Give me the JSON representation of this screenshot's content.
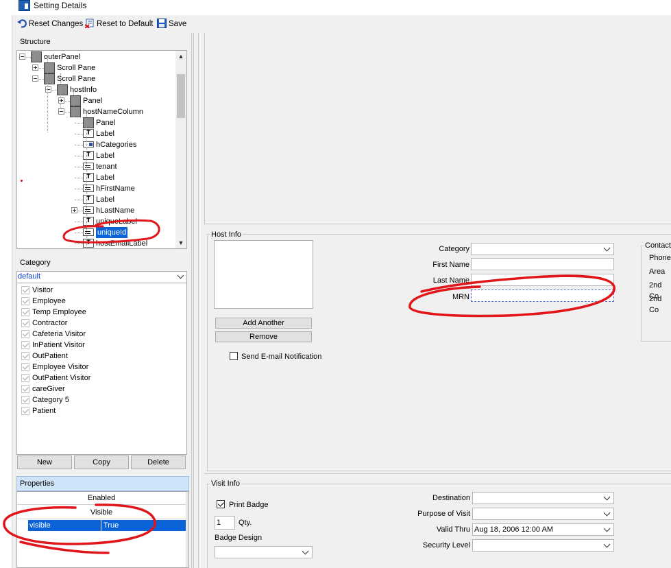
{
  "window": {
    "title": "Setting Details",
    "app_icon": "app-icon"
  },
  "toolbar": {
    "reset_changes": "Reset Changes",
    "reset_default": "Reset to Default",
    "save": "Save"
  },
  "structure": {
    "title": "Structure",
    "nodes": [
      {
        "label": "outerPanel",
        "icon": "panel-icon",
        "expander": "minus"
      },
      {
        "label": "Scroll Pane",
        "icon": "panel-icon",
        "expander": "plus"
      },
      {
        "label": "Scroll Pane",
        "icon": "panel-icon",
        "expander": "minus"
      },
      {
        "label": "hostInfo",
        "icon": "panel-icon",
        "expander": "minus"
      },
      {
        "label": "Panel",
        "icon": "panel-icon",
        "expander": "plus"
      },
      {
        "label": "hostNameColumn",
        "icon": "panel-icon",
        "expander": "minus"
      },
      {
        "label": "Panel",
        "icon": "panel-icon",
        "expander": ""
      },
      {
        "label": "Label",
        "icon": "label-icon",
        "expander": ""
      },
      {
        "label": "hCategories",
        "icon": "combobox-icon",
        "expander": ""
      },
      {
        "label": "Label",
        "icon": "label-icon",
        "expander": ""
      },
      {
        "label": "tenant",
        "icon": "textfield-icon",
        "expander": ""
      },
      {
        "label": "Label",
        "icon": "label-icon",
        "expander": ""
      },
      {
        "label": "hFirstName",
        "icon": "textfield-icon",
        "expander": ""
      },
      {
        "label": "Label",
        "icon": "label-icon",
        "expander": ""
      },
      {
        "label": "hLastName",
        "icon": "textfield-icon",
        "expander": "plus"
      },
      {
        "label": "uniqueLabel",
        "icon": "label-icon",
        "expander": ""
      },
      {
        "label": "uniqueId",
        "icon": "textfield-icon",
        "expander": "",
        "selected": true
      },
      {
        "label": "hostEmailLabel",
        "icon": "label-icon",
        "expander": ""
      }
    ]
  },
  "category": {
    "title": "Category",
    "selected": "default",
    "items": [
      "Visitor",
      "Employee",
      "Temp Employee",
      "Contractor",
      "Cafeteria Visitor",
      "InPatient Visitor",
      "OutPatient",
      "Employee Visitor",
      "OutPatient Visitor",
      "careGiver",
      "Category 5",
      "Patient"
    ],
    "buttons": {
      "new": "New",
      "copy": "Copy",
      "delete": "Delete"
    }
  },
  "properties": {
    "title": "Properties",
    "rows": [
      "Enabled",
      "Visible"
    ],
    "selected_name": "visible",
    "selected_value": "True"
  },
  "host_info": {
    "title": "Host Info",
    "category_label": "Category",
    "first_name_label": "First Name",
    "last_name_label": "Last Name",
    "mrn_label": "MRN",
    "add_another": "Add Another",
    "remove": "Remove",
    "send_email": "Send E-mail Notification",
    "contact_title": "Contact",
    "contact_rows": [
      "Phone",
      "Area",
      "2nd Co",
      "2nd Co"
    ]
  },
  "visit_info": {
    "title": "Visit Info",
    "print_badge": "Print Badge",
    "qty_value": "1",
    "qty_label": "Qty.",
    "badge_design": "Badge Design",
    "destination": "Destination",
    "purpose": "Purpose of Visit",
    "valid_thru": "Valid Thru",
    "valid_thru_value": "Aug 18, 2006 12:00 AM",
    "security_level": "Security Level"
  },
  "colors": {
    "selection": "#0a64d8",
    "annotation": "#e0161b",
    "properties_header": "#cfe4f8"
  }
}
